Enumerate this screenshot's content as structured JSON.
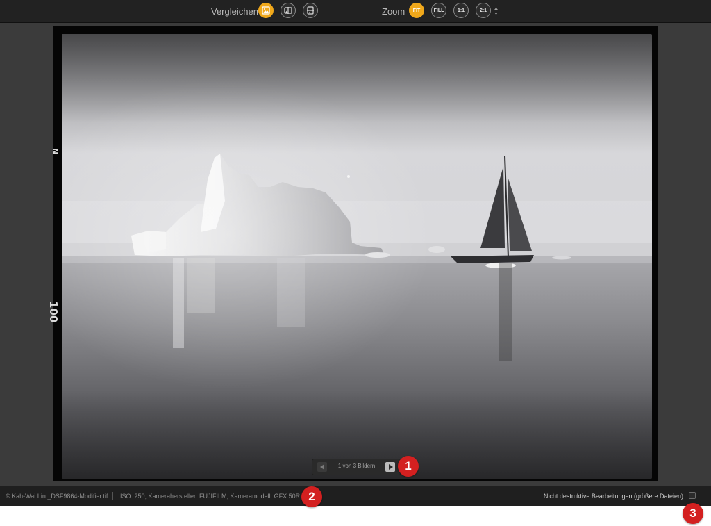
{
  "toolbar": {
    "compare_label": "Vergleichen",
    "zoom_label": "Zoom",
    "zoom_fit": "FIT",
    "zoom_fill": "FILL",
    "zoom_1_1": "1:1",
    "zoom_2_1": "2:1",
    "accent_color": "#f0a81b"
  },
  "pager": {
    "text": "1 von 3 Bildern"
  },
  "status": {
    "copyright": "© Kah-Wai Lin _DSF9864-Modifier.tif",
    "meta": "ISO: 250, Kamerahersteller: FUJIFILM, Kameramodell: GFX 50R",
    "non_destructive_label": "Nicht destruktive Bearbeitungen (größere Dateien)",
    "non_destructive_checked": false
  },
  "markers": [
    "1",
    "2",
    "3"
  ],
  "marker_color": "#d32020",
  "film_edge": {
    "mark_top": "N",
    "mark_bottom": "100"
  }
}
